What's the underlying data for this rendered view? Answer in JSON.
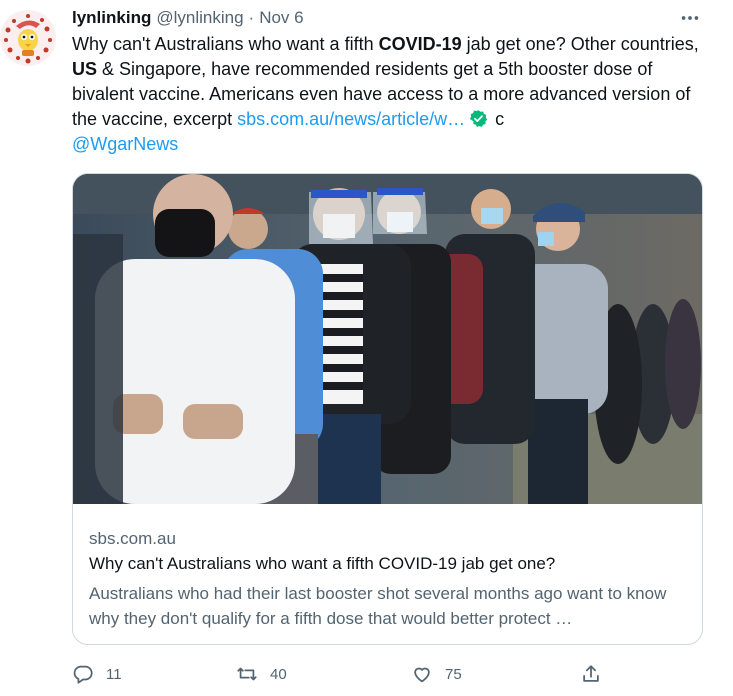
{
  "tweet": {
    "author_name": "lynlinking",
    "author_handle": "@lynlinking",
    "separator": "·",
    "date": "Nov 6",
    "text_1": "Why can't Australians who want a fifth ",
    "bold_1": "COVID-19",
    "text_2": " jab get one? Other countries, ",
    "bold_2": "US",
    "text_3": " & Singapore, have recommended residents get a 5th booster dose of bivalent vaccine. Americans even have access to a more advanced version of the vaccine, excerpt ",
    "link": "sbs.com.au/news/article/w…",
    "text_4": " c",
    "mention": "@WgarNews"
  },
  "card": {
    "domain": "sbs.com.au",
    "title": "Why can't Australians who want a fifth COVID-19 jab get one?",
    "description": "Australians who had their last booster shot several months ago want to know why they don't qualify for a fifth dose that would better protect …"
  },
  "actions": {
    "replies": "11",
    "retweets": "40",
    "likes": "75"
  },
  "colors": {
    "link": "#1d9bf0",
    "secondary_text": "#536471",
    "border": "#cfd9de",
    "verified": "#00ba7c"
  },
  "icons": {
    "more": "more-dots-icon",
    "reply": "reply-icon",
    "retweet": "retweet-icon",
    "like": "heart-icon",
    "share": "share-icon",
    "verified": "verified-badge-icon"
  }
}
